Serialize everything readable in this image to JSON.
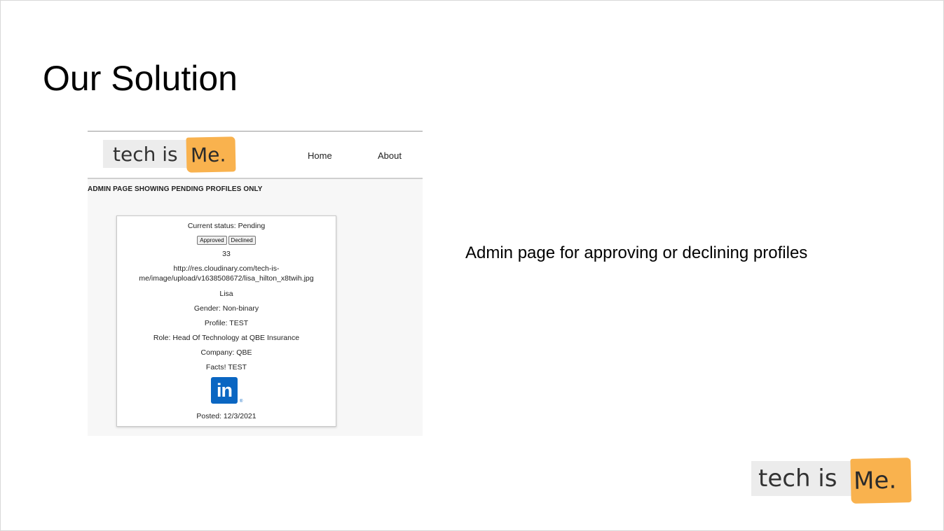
{
  "slide": {
    "title": "Our Solution",
    "caption": "Admin page for approving or declining profiles"
  },
  "logo": {
    "part1": "tech is",
    "part2": "Me.",
    "accent_color": "#f9b24e"
  },
  "screenshot": {
    "nav": {
      "home": "Home",
      "about": "About"
    },
    "heading": "ADMIN PAGE SHOWING PENDING PROFILES ONLY",
    "card": {
      "status": "Current status: Pending",
      "approve_label": "Approved",
      "decline_label": "Declined",
      "id": "33",
      "image_url_line1": "http://res.cloudinary.com/tech-is-",
      "image_url_line2": "me/image/upload/v1638508672/lisa_hilton_x8twih.jpg",
      "name": "Lisa",
      "gender": "Gender: Non-binary",
      "profile": "Profile: TEST",
      "role": "Role: Head Of Technology at QBE Insurance",
      "company": "Company: QBE",
      "facts": "Facts! TEST",
      "linkedin_icon": "linkedin-icon",
      "linkedin_text": "in",
      "linkedin_reg": "®",
      "linkedin_color": "#0a66c2",
      "posted": "Posted: 12/3/2021"
    }
  }
}
